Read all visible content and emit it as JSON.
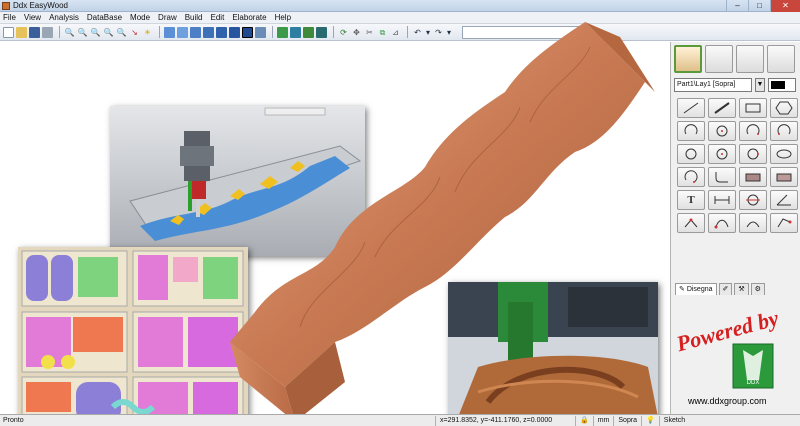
{
  "window": {
    "title": "Ddx EasyWood",
    "minimize": "–",
    "maximize": "□",
    "close": "✕"
  },
  "menu": [
    "File",
    "View",
    "Analysis",
    "DataBase",
    "Mode",
    "Draw",
    "Build",
    "Edit",
    "Elaborate",
    "Help"
  ],
  "toolbar": {
    "groups": [
      [
        "new-icon",
        "open-icon",
        "save-icon",
        "print-icon"
      ],
      [
        "zoom-in-icon",
        "zoom-out-icon",
        "zoom-window-icon",
        "zoom-all-icon",
        "zoom-prev-icon",
        "pick-icon",
        "refresh-icon"
      ],
      [
        "view-3d-icon",
        "view-top-icon",
        "view-front-icon",
        "view-side-icon",
        "view-iso-icon",
        "view-solid-icon",
        "view-wire-icon",
        "view-shaded-icon"
      ],
      [
        "snap-icon",
        "measure-icon",
        "select-icon",
        "layer-icon"
      ],
      [
        "rotate-icon",
        "transform-icon",
        "trim-icon",
        "offset-icon",
        "fillet-icon"
      ],
      [
        "undo-icon",
        "redo-icon"
      ]
    ]
  },
  "panel": {
    "layer": "Part1\\Lay1 [Sopra]",
    "color": "#000000",
    "tabs": [
      "Disegna",
      "",
      "",
      ""
    ]
  },
  "status": {
    "left": "Pronto",
    "coords": "x=291.8352, y=-411.1760, z=0.0000",
    "unit": "mm",
    "view": "Sopra",
    "mode": "Sketch"
  },
  "branding": {
    "powered": "Powered by",
    "logo": "DDX",
    "url": "www.ddxgroup.com"
  }
}
